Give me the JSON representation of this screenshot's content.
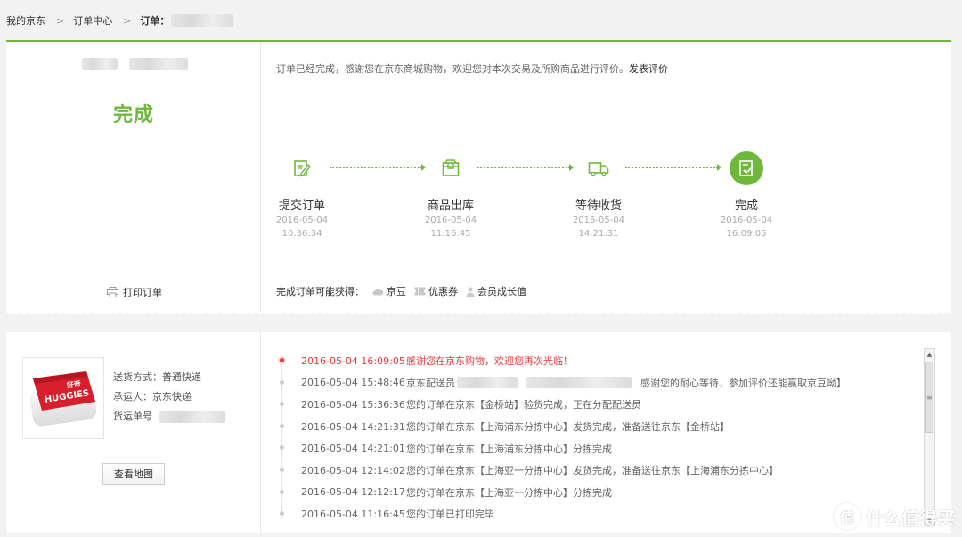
{
  "breadcrumb": {
    "home": "我的京东",
    "center": "订单中心",
    "order_label": "订单："
  },
  "status": {
    "title": "完成",
    "print_label": "打印订单",
    "message": "订单已经完成，感谢您在京东商城购物，欢迎您对本次交易及所购商品进行评价。",
    "review_link": "发表评价"
  },
  "steps": [
    {
      "name": "提交订单",
      "date": "2016-05-04",
      "time": "10:36:34",
      "icon": "form-edit-icon"
    },
    {
      "name": "商品出库",
      "date": "2016-05-04",
      "time": "11:16:45",
      "icon": "box-icon"
    },
    {
      "name": "等待收货",
      "date": "2016-05-04",
      "time": "14:21:31",
      "icon": "truck-icon"
    },
    {
      "name": "完成",
      "date": "2016-05-04",
      "time": "16:09:05",
      "icon": "check-doc-icon"
    }
  ],
  "gains": {
    "label": "完成订单可能获得：",
    "items": [
      "京豆",
      "优惠券",
      "会员成长值"
    ]
  },
  "shipping": {
    "method_label": "送货方式：",
    "method": "普通快递",
    "carrier_label": "承运人：",
    "carrier": "京东快递",
    "tracking_label": "货运单号",
    "map_button": "查看地图",
    "product_brand": "HUGGIES",
    "product_brand_cn": "好奇"
  },
  "tracking": [
    {
      "time": "2016-05-04 16:09:05",
      "desc": "感谢您在京东购物，欢迎您再次光临！"
    },
    {
      "time": "2016-05-04 15:48:46",
      "desc_a": "京东配送员",
      "desc_b": "感谢您的耐心等待，参加评价还能赢取京豆呦】"
    },
    {
      "time": "2016-05-04 15:36:36",
      "desc": "您的订单在京东【金桥站】验货完成，正在分配配送员"
    },
    {
      "time": "2016-05-04 14:21:31",
      "desc": "您的订单在京东【上海浦东分拣中心】发货完成，准备送往京东【金桥站】"
    },
    {
      "time": "2016-05-04 14:21:01",
      "desc": "您的订单在京东【上海浦东分拣中心】分拣完成"
    },
    {
      "time": "2016-05-04 12:14:02",
      "desc": "您的订单在京东【上海亚一分拣中心】发货完成，准备送往京东【上海浦东分拣中心】"
    },
    {
      "time": "2016-05-04 12:12:17",
      "desc": "您的订单在京东【上海亚一分拣中心】分拣完成"
    },
    {
      "time": "2016-05-04 11:16:45",
      "desc": "您的订单已打印完毕"
    }
  ],
  "watermark": {
    "glyph": "值",
    "text": "什么值得买"
  },
  "colors": {
    "accent_green": "#6fb83c",
    "alert_red": "#e4393c"
  }
}
